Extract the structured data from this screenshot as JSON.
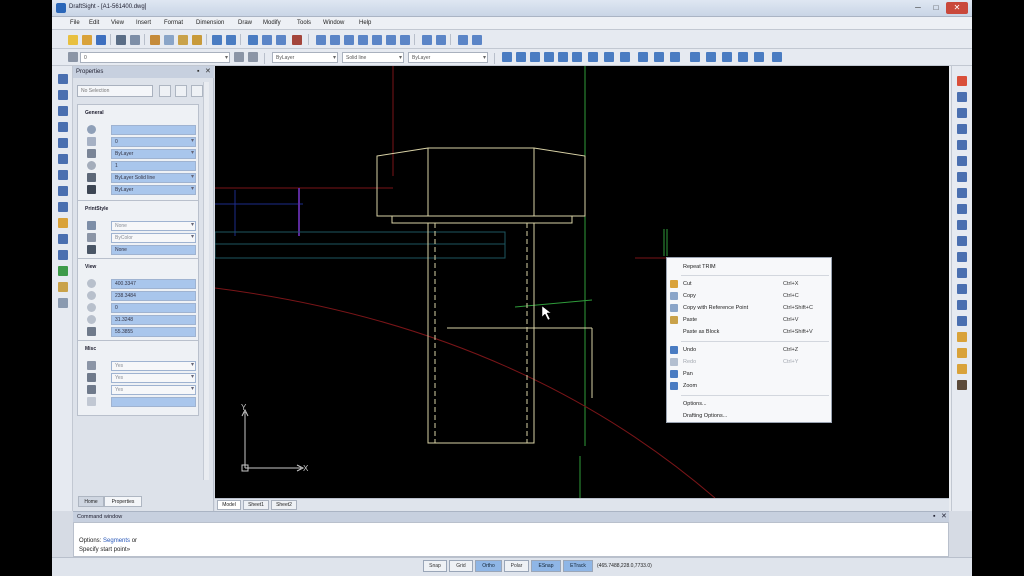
{
  "window": {
    "title": "DraftSight - [A1-561400.dwg]",
    "minimize": "─",
    "maximize": "□",
    "close": "✕"
  },
  "menu": [
    "File",
    "Edit",
    "View",
    "Insert",
    "Format",
    "Dimension",
    "Draw",
    "Modify",
    "Tools",
    "Window",
    "Help"
  ],
  "toolbar2": {
    "layer": "0",
    "color": "ByLayer",
    "linestyle": "Solid line",
    "lineweight": "ByLayer"
  },
  "properties": {
    "title": "Properties",
    "selection": "No Selection",
    "general": {
      "title": "General",
      "values": [
        "",
        "0",
        "ByLayer",
        "1",
        "ByLayer  Solid line",
        "ByLayer"
      ]
    },
    "printstyle": {
      "title": "PrintStyle",
      "values": [
        "None",
        "ByColor",
        "None"
      ]
    },
    "view": {
      "title": "View",
      "values": [
        "400.3347",
        "238.3484",
        "0",
        "31.3248",
        "55.3855"
      ]
    },
    "misc": {
      "title": "Misc",
      "values": [
        "Yes",
        "Yes",
        "Yes",
        ""
      ]
    },
    "tabs": [
      "Home",
      "Properties"
    ]
  },
  "sheet_tabs": [
    "Model",
    "Sheet1",
    "Sheet2"
  ],
  "axis_labels": {
    "x": "X",
    "y": "Y"
  },
  "context_menu": {
    "items": [
      {
        "label": "Repeat TRIM",
        "shortcut": "",
        "enabled": true,
        "icon": ""
      },
      {
        "label": "Cut",
        "shortcut": "Ctrl+X",
        "enabled": true,
        "icon": "#d9a23a"
      },
      {
        "label": "Copy",
        "shortcut": "Ctrl+C",
        "enabled": true,
        "icon": "#8aa5c8"
      },
      {
        "label": "Copy with Reference Point",
        "shortcut": "Ctrl+Shift+C",
        "enabled": true,
        "icon": "#8aa5c8"
      },
      {
        "label": "Paste",
        "shortcut": "Ctrl+V",
        "enabled": true,
        "icon": "#c9a24a"
      },
      {
        "label": "Paste as Block",
        "shortcut": "Ctrl+Shift+V",
        "enabled": true,
        "icon": ""
      },
      {
        "label": "Undo",
        "shortcut": "Ctrl+Z",
        "enabled": true,
        "icon": "#4a7cc2"
      },
      {
        "label": "Redo",
        "shortcut": "Ctrl+Y",
        "enabled": false,
        "icon": "#b3bfd0"
      },
      {
        "label": "Pan",
        "shortcut": "",
        "enabled": true,
        "icon": "#4a7cc2"
      },
      {
        "label": "Zoom",
        "shortcut": "",
        "enabled": true,
        "icon": "#4a7cc2"
      },
      {
        "label": "Options...",
        "shortcut": "",
        "enabled": true,
        "icon": ""
      },
      {
        "label": "Drafting Options...",
        "shortcut": "",
        "enabled": true,
        "icon": ""
      }
    ]
  },
  "command_window": {
    "title": "Command window",
    "pin": "▪",
    "close": "✕",
    "line1_prefix": "Options:",
    "line1_link": "Segments",
    "line1_suffix": "or",
    "line2": "Specify start point»"
  },
  "status": {
    "buttons": [
      {
        "label": "Snap",
        "on": false
      },
      {
        "label": "Grid",
        "on": false
      },
      {
        "label": "Ortho",
        "on": true
      },
      {
        "label": "Polar",
        "on": false
      },
      {
        "label": "ESnap",
        "on": true
      },
      {
        "label": "ETrack",
        "on": true
      }
    ],
    "coords": "(465.7488,228.0,7733.0)"
  },
  "colors": {
    "canvas": "#000000",
    "bolt": "#d9d2a6",
    "guide_green": "#2f9b3a",
    "guide_red": "#7a1518",
    "guide_blue": "#1d2d8a",
    "purple": "#5b2a9b",
    "teal": "#1e5660"
  }
}
